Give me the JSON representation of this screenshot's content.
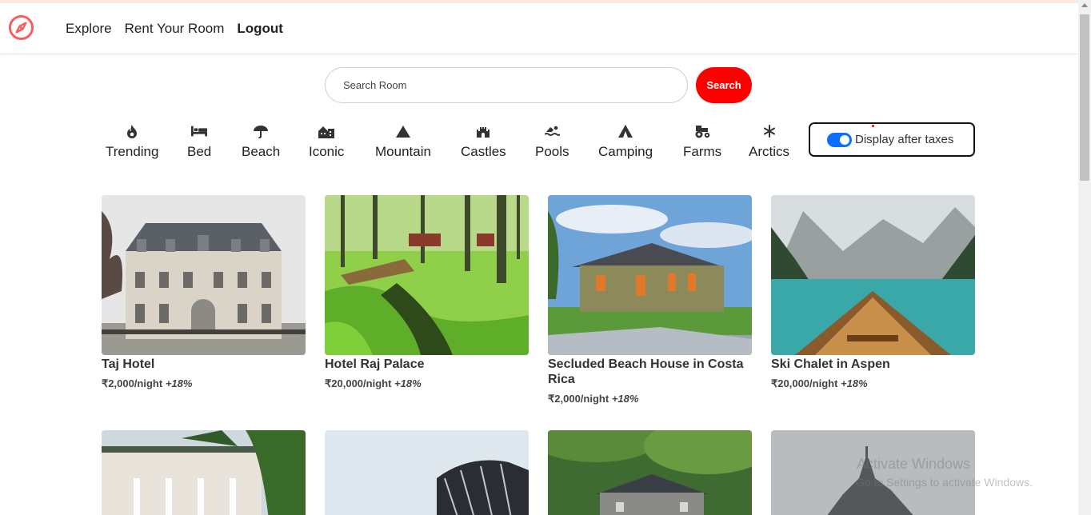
{
  "nav": {
    "links": [
      "Explore",
      "Rent Your Room",
      "Logout"
    ]
  },
  "search": {
    "placeholder": "Search Room",
    "button_label": "Search"
  },
  "filters": [
    {
      "label": "Trending",
      "icon": "fire-icon"
    },
    {
      "label": "Bed",
      "icon": "bed-icon"
    },
    {
      "label": "Beach",
      "icon": "umbrella-beach-icon"
    },
    {
      "label": "Iconic",
      "icon": "city-icon"
    },
    {
      "label": "Mountain",
      "icon": "mountain-icon"
    },
    {
      "label": "Castles",
      "icon": "castle-icon"
    },
    {
      "label": "Pools",
      "icon": "swimmer-icon"
    },
    {
      "label": "Camping",
      "icon": "tent-icon"
    },
    {
      "label": "Farms",
      "icon": "tractor-icon"
    },
    {
      "label": "Arctics",
      "icon": "snowflake-icon"
    }
  ],
  "tax_toggle": {
    "label": "Display after taxes",
    "checked": true
  },
  "listings": [
    {
      "title": "Taj Hotel",
      "price": "₹2,000/night",
      "tax": "+18%"
    },
    {
      "title": "Hotel Raj Palace",
      "price": "₹20,000/night",
      "tax": "+18%"
    },
    {
      "title": "Secluded Beach House in Costa Rica",
      "price": "₹2,000/night",
      "tax": "+18%"
    },
    {
      "title": "Ski Chalet in Aspen",
      "price": "₹20,000/night",
      "tax": "+18%"
    }
  ],
  "watermark": {
    "line1": "Activate Windows",
    "line2": "Go to Settings to activate Windows."
  },
  "colors": {
    "brand": "#fe5a5a",
    "search_button": "#fe0000",
    "toggle": "#0d6efd"
  }
}
